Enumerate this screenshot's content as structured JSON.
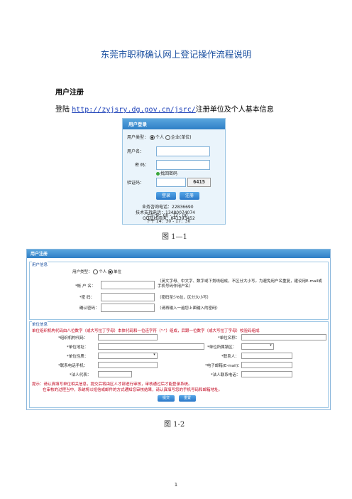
{
  "doc": {
    "title": "东莞市职称确认网上登记操作流程说明",
    "section_heading": "用户注册",
    "intro_prefix": "登陆 ",
    "intro_link": "http://zyjsry.dg.gov.cn/jsrc/",
    "intro_suffix": "注册单位及个人基本信息",
    "caption1": "图 1—1",
    "caption2": "图 1-2",
    "page_number": "1"
  },
  "login": {
    "header": "用户登录",
    "user_type_label": "用户类型：",
    "opt_personal": "个人",
    "opt_company": "企业(单位)",
    "username_label": "用户名：",
    "password_label": "密  码：",
    "forgot": "找回密码",
    "captcha_label": "验证码：",
    "captcha_value": "6415",
    "login_btn": "登录",
    "register_btn": "注册",
    "info1": "业务咨询电话：22836690",
    "info2": "技术支持电话：13480074074",
    "info3": "QQ在线咨询：841393452",
    "info4": "上午 9：00 - 12：00",
    "info5": "下午 14：30 - 17：30"
  },
  "reg": {
    "header": "用户注册",
    "user_section": "用户信息",
    "user_type_label": "用户类型：",
    "opt_personal": "个人",
    "opt_unit": "单位",
    "account_label": "*帐 户 名：",
    "account_hint": "（英文字母、中文字、数字或下划线组成，不区分大小写。为避免用户名重复，建议用E-mail或手机号码作用户名）",
    "password_label": "*密    码：",
    "password_hint": "（密码至少6位，区分大小写）",
    "confirm_label": "确认密码：",
    "confirm_hint": "（请再输入一遍您上面输入的密码）",
    "unit_section": "单位信息",
    "org_note": "单位组织机构代码由八位数字（或大写拉丁字母）本体代码和一位连字符（\"-\"）组成，后跟一位数字（或大写拉丁字母）校验码组成",
    "org_code_label": "*组织机构代码：",
    "unit_name_label": "*单位名称：",
    "unit_addr_label": "*单位地址：",
    "unit_district_label": "*单位所属镇区：",
    "unit_nature_label": "*单位性质：",
    "contact_label": "*联系人：",
    "contact_phone_label": "*联系电话手机：",
    "email_label": "*电子邮箱(E-mail)：",
    "legal_label": "*法人代表：",
    "legal_phone_label": "*法人联系电话：",
    "tip1": "提示：请认真填写单位相关信息，提交后将由区人才部进行审核，审核通过后才能登录系统。",
    "tip2": "在审核的过程当中，系统将以短信或邮件的方式通知您审核结果，请认真填写您的手机号码和邮箱地址。",
    "submit_btn": "提交",
    "reset_btn": "重置"
  }
}
